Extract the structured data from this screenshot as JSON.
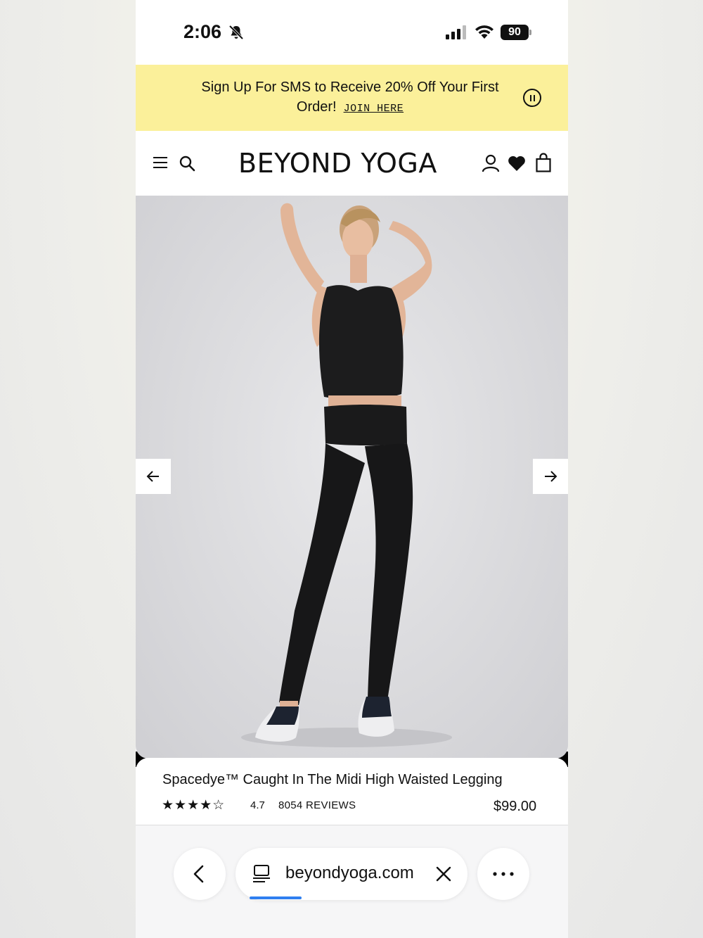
{
  "status_bar": {
    "time": "2:06",
    "battery": "90",
    "icons": [
      "bell-slash-icon",
      "signal-icon",
      "wifi-icon",
      "battery-icon"
    ]
  },
  "promo": {
    "text": "Sign Up For SMS to Receive 20% Off Your First Order!",
    "link": "JOIN HERE",
    "pause_icon": "pause-icon"
  },
  "header": {
    "logo": "BEYOND YOGA",
    "icons": [
      "menu-icon",
      "search-icon",
      "account-icon",
      "wishlist-heart-icon",
      "cart-bag-icon"
    ]
  },
  "gallery": {
    "prev_icon": "arrow-left-icon",
    "next_icon": "arrow-right-icon"
  },
  "product": {
    "title": "Spacedye™ Caught In The Midi High Waisted Legging",
    "stars": "★★★★☆",
    "star_value": 4.7,
    "rating": "4.7",
    "reviews": "8054 REVIEWS",
    "price": "$99.00"
  },
  "browser": {
    "url": "beyondyoga.com",
    "load_progress": 0.22,
    "icons": [
      "back-chevron-icon",
      "page-icon",
      "close-icon",
      "more-dots-icon"
    ]
  },
  "colors": {
    "promo_bg": "#fbf09a",
    "progress": "#2f7ff0",
    "text": "#111111"
  }
}
